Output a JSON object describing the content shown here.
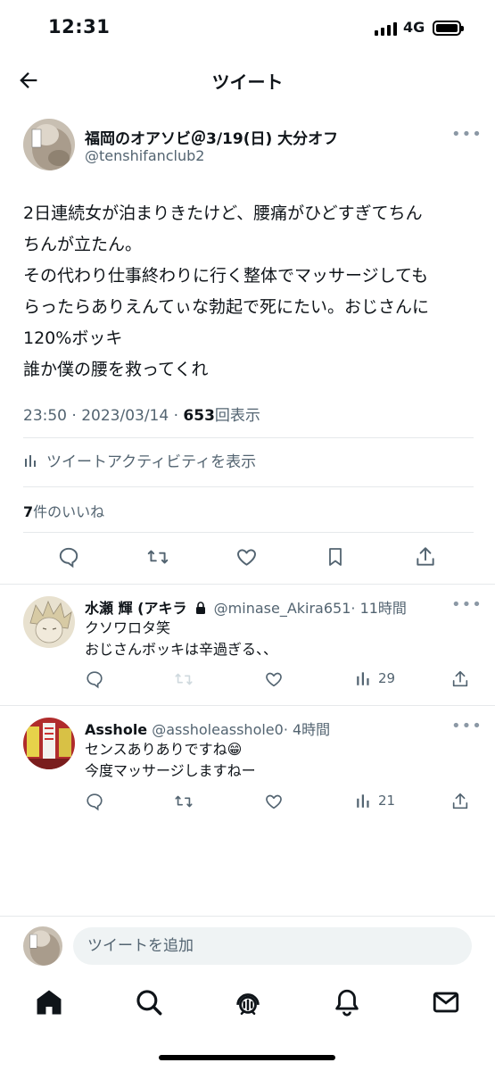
{
  "status_bar": {
    "time": "12:31",
    "network": "4G"
  },
  "header": {
    "title": "ツイート",
    "back_icon": "arrow-left-icon"
  },
  "main_tweet": {
    "author_name": "福岡のオアソビ＠3/19(日) 大分オフ",
    "handle": "@tenshifanclub2",
    "body_lines": [
      "2日連続女が泊まりきたけど、腰痛がひどすぎてちん",
      "ちんが立たん。",
      "その代わり仕事終わりに行く整体でマッサージしても",
      "らったらありえんてぃな勃起で死にたい。おじさんに",
      "120%ボッキ",
      "誰か僕の腰を救ってくれ"
    ],
    "meta_time": "23:50 · 2023/03/14 · ",
    "views_count": "653",
    "views_label": "回表示",
    "activity_label": "ツイートアクティビティを表示",
    "likes_count": "7",
    "likes_label": "件のいいね"
  },
  "replies": [
    {
      "name": "水瀬 輝 (アキラ",
      "handle": "@minase_Akira651",
      "time": "· 11時間",
      "lines": [
        "クソワロタ笑",
        "おじさんボッキは辛過ぎる、、"
      ],
      "views": "29",
      "locked": true
    },
    {
      "name": "Asshole",
      "handle": "@assholeasshole0",
      "time": "· 4時間",
      "lines": [
        "センスありありですね😁",
        "今度マッサージしますねー"
      ],
      "views": "21",
      "locked": false
    }
  ],
  "compose": {
    "placeholder": "ツイートを追加"
  },
  "tabs": [
    "home-icon",
    "search-icon",
    "spaces-icon",
    "notifications-icon",
    "messages-icon"
  ]
}
